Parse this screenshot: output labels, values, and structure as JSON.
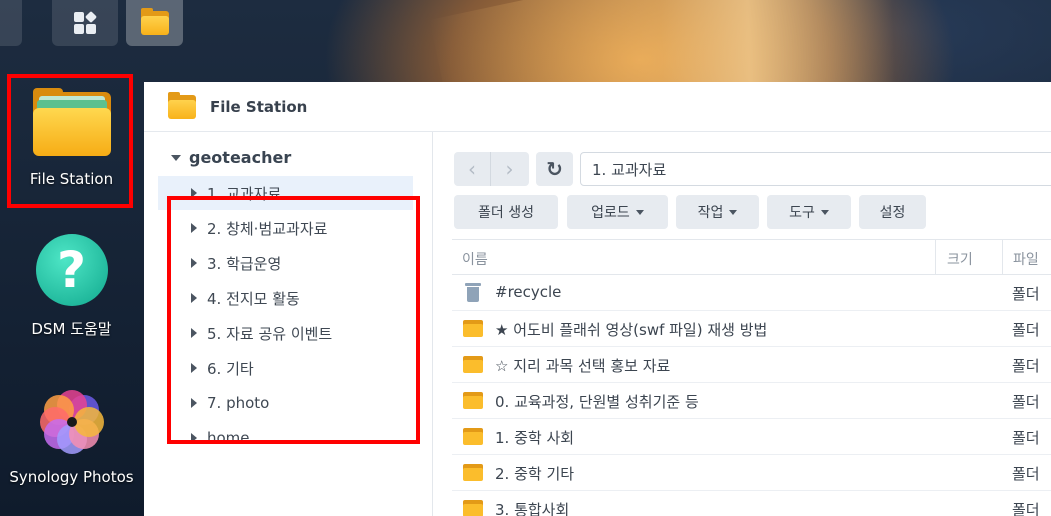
{
  "desktop": {
    "icons": [
      {
        "label": "File Station"
      },
      {
        "label": "DSM 도움말"
      },
      {
        "label": "Synology Photos"
      }
    ],
    "help_glyph": "?",
    "photo_petal_colors": [
      "#f6b93b",
      "#f78fb3",
      "#a29bfe",
      "#c56cf0",
      "#ff6b6b",
      "#ff9f43",
      "#e84393",
      "#6c5ce7"
    ]
  },
  "window": {
    "title": "File Station"
  },
  "tree": {
    "root": "geoteacher",
    "items": [
      {
        "label": "1. 교과자료",
        "selected": true
      },
      {
        "label": "2. 창체·범교과자료"
      },
      {
        "label": "3. 학급운영"
      },
      {
        "label": "4. 전지모 활동"
      },
      {
        "label": "5. 자료 공유 이벤트"
      },
      {
        "label": "6. 기타"
      },
      {
        "label": "7. photo"
      },
      {
        "label": "home"
      }
    ]
  },
  "nav": {
    "back": "‹",
    "forward": "›",
    "refresh": "↻",
    "path": "1. 교과자료"
  },
  "toolbar": {
    "create_folder": "폴더 생성",
    "upload": "업로드",
    "action": "작업",
    "tools": "도구",
    "settings": "설정"
  },
  "list": {
    "headers": {
      "name": "이름",
      "size": "크기",
      "type": "파일"
    },
    "rows": [
      {
        "name": "#recycle",
        "type": "폴더",
        "icon": "trash-icon"
      },
      {
        "name": "★ 어도비 플래쉬 영상(swf 파일) 재생 방법",
        "type": "폴더",
        "icon": "folder-icon"
      },
      {
        "name": "☆ 지리 과목 선택 홍보 자료",
        "type": "폴더",
        "icon": "folder-icon"
      },
      {
        "name": "0. 교육과정, 단원별 성취기준 등",
        "type": "폴더",
        "icon": "folder-icon"
      },
      {
        "name": "1. 중학 사회",
        "type": "폴더",
        "icon": "folder-icon"
      },
      {
        "name": "2. 중학 기타",
        "type": "폴더",
        "icon": "folder-icon"
      },
      {
        "name": "3. 통합사회",
        "type": "폴더",
        "icon": "folder-icon"
      }
    ]
  },
  "highlight_color": "#ff0000"
}
